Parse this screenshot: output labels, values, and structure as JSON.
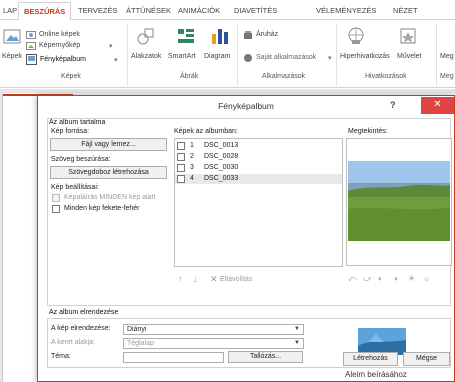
{
  "ribbon": {
    "tabs": [
      "LAP",
      "BESZÚRÁS",
      "TERVEZÉS",
      "ÁTTŰNÉSEK",
      "ANIMÁCIÓK",
      "DIAVETÍTÉS",
      "VÉLEMÉNYEZÉS",
      "NÉZET"
    ],
    "active_tab": "BESZÚRÁS",
    "kepek": {
      "kepek": "Képek",
      "online": "Online képek",
      "keperny": "Képernyőkép",
      "fenykepalbum": "Fényképalbum",
      "group": "Képek"
    },
    "abrak": {
      "alakzatok": "Alakzatok",
      "smartart": "SmartArt",
      "diagram": "Diagram",
      "group": "Ábrák"
    },
    "alkalmazasok": {
      "aruhaz": "Áruház",
      "sajat": "Saját alkalmazások",
      "group": "Alkalmazások"
    },
    "hivatkozasok": {
      "hiper": "Hiperhivatkozás",
      "muvelet": "Művelet",
      "group": "Hivatkozások"
    },
    "cut_right": {
      "top": "Meg",
      "bottom": "Meg"
    }
  },
  "dialog": {
    "title": "Fényképalbum",
    "help": "?",
    "close": "✕",
    "content_section": "Az album tartalma",
    "source_label": "Kép forrása:",
    "file_disk_button": "Fájl vagy lemez...",
    "text_insert_label": "Szöveg beszúrása:",
    "new_textbox_button": "Szövegdoboz létrehozása",
    "image_options_label": "Kép beállításai:",
    "caption_check": "Képaláírás MINDEN kép alatt",
    "bw_check": "Minden kép fekete-fehér",
    "album_images_label": "Képek az albumban:",
    "images": [
      {
        "num": "1",
        "name": "DSC_0013"
      },
      {
        "num": "2",
        "name": "DSC_0028"
      },
      {
        "num": "3",
        "name": "DSC_0030"
      },
      {
        "num": "4",
        "name": "DSC_0033"
      }
    ],
    "remove_button": "Eltávolítás",
    "preview_label": "Megtekintés:",
    "layout_section": "Az album elrendezése",
    "layout_label": "A kép elrendezése:",
    "layout_value": "Diányi",
    "frame_label": "A keret alakja:",
    "frame_value": "Téglalap",
    "theme_label": "Téma:",
    "theme_value": "",
    "browse_button": "Tallózás...",
    "create_button": "Létrehozás",
    "cancel_button": "Mégse"
  },
  "slide_text": "Aleim beírásához"
}
